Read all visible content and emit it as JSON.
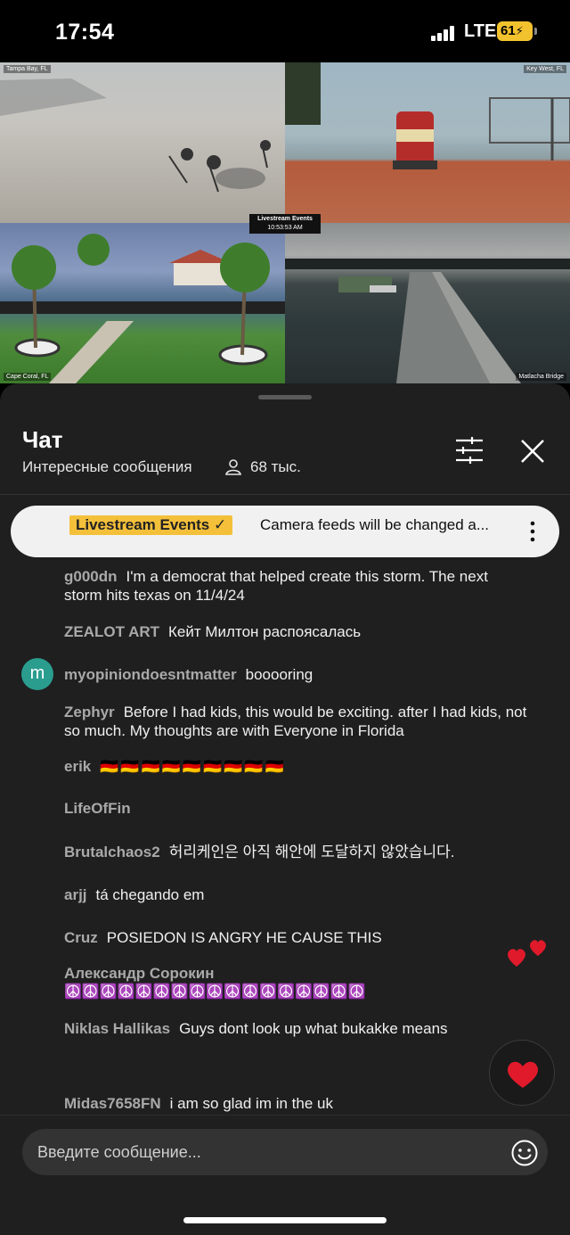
{
  "status_bar": {
    "time": "17:54",
    "network": "LTE",
    "battery": "61"
  },
  "video": {
    "cams": [
      {
        "label": "Tampa Bay, FL"
      },
      {
        "label": "Key West, FL"
      },
      {
        "label": "Cape Coral, FL"
      },
      {
        "label": "Matlacha Bridge"
      }
    ],
    "center_title": "Livestream Events",
    "center_time": "10:53:53 AM"
  },
  "chat": {
    "title": "Чат",
    "subtitle": "Интересные сообщения",
    "viewers": "68 тыс.",
    "pinned": {
      "author": "Livestream Events",
      "text": "Camera feeds will be changed a..."
    },
    "messages": [
      {
        "author": "g000dn",
        "text": "I'm a democrat that helped create this storm. The next storm hits texas on 11/4/24"
      },
      {
        "author": "ZEALOT ART",
        "text": "Кейт Милтон распоясалась"
      },
      {
        "author": "myopiniondoesntmatter",
        "text": "booooring",
        "avatar": "m"
      },
      {
        "author": "Zephyr",
        "text": "Before I had kids, this would be exciting. after I had kids, not so much. My thoughts are with Everyone in Florida"
      },
      {
        "author": "erik",
        "text": "🇩🇪🇩🇪🇩🇪🇩🇪🇩🇪🇩🇪🇩🇪🇩🇪🇩🇪"
      },
      {
        "author": "LifeOfFin",
        "text": ""
      },
      {
        "author": "Brutalchaos2",
        "text": "허리케인은 아직 해안에 도달하지 않았습니다."
      },
      {
        "author": "arjj",
        "text": "tá chegando em"
      },
      {
        "author": "Cruz",
        "text": "POSIEDON IS ANGRY HE CAUSE THIS"
      },
      {
        "author": "Александр Сорокин",
        "text": "☮️☮️☮️☮️☮️☮️☮️☮️☮️☮️☮️☮️☮️☮️☮️☮️☮️"
      },
      {
        "author": "Niklas Hallikas",
        "text": "Guys dont look up what bukakke means"
      },
      {
        "author": "Midas7658FN",
        "text": "i am so glad im in the uk"
      }
    ],
    "input_placeholder": "Введите сообщение..."
  },
  "icons": {
    "filter": "filter-sliders-icon",
    "close": "close-icon",
    "more": "more-vertical-icon",
    "emoji": "emoji-icon",
    "heart": "heart-icon",
    "viewers": "person-icon"
  },
  "colors": {
    "pinned_badge": "#f4c03a",
    "avatar_m": "#2a9d8f",
    "heart": "#e01a2b"
  }
}
